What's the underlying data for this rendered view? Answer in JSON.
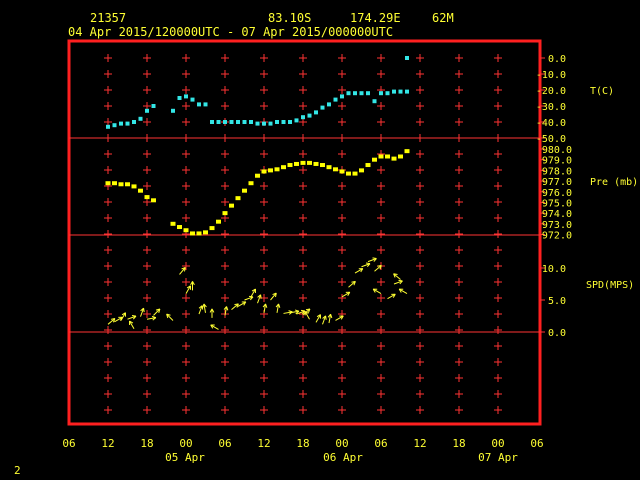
{
  "header": {
    "station_id": "21357",
    "latitude": "83.10S",
    "longitude": "174.29E",
    "elevation": "62M",
    "period": "04 Apr 2015/120000UTC - 07 Apr 2015/000000UTC"
  },
  "page_number": "2",
  "colors": {
    "frame": "#ff2020",
    "temperature": "#33e6e6",
    "pressure": "#ffff00",
    "wind": "#ffff33",
    "text": "#ffff33",
    "grid": "#ff3333"
  },
  "chart_data": [
    {
      "type": "scatter",
      "name": "temperature",
      "ylabel": "T(C)",
      "yticks": [
        "0.0",
        "-10.0",
        "-20.0",
        "-30.0",
        "-40.0",
        "-50.0"
      ],
      "ylim": [
        -50,
        0
      ],
      "x_hours": [
        2,
        3,
        4,
        5,
        6,
        7,
        8,
        9,
        12,
        13,
        14,
        15,
        16,
        17,
        18,
        19,
        20,
        21,
        22,
        23,
        24,
        25,
        26,
        27,
        28,
        29,
        30,
        31,
        32,
        33,
        34,
        35,
        36,
        37,
        38,
        39,
        40,
        41,
        42,
        43,
        44,
        45,
        46,
        47,
        48
      ],
      "values": [
        -43,
        -42,
        -41,
        -41,
        -40,
        -38,
        -33,
        -30,
        -33,
        -25,
        -24,
        -26,
        -29,
        -29,
        -40,
        -40,
        -40,
        -40,
        -40,
        -40,
        -40,
        -41,
        -41,
        -41,
        -40,
        -40,
        -40,
        -39,
        -37,
        -36,
        -34,
        -31,
        -29,
        -26,
        -24,
        -22,
        -22,
        -22,
        -22,
        -27,
        -22,
        -22,
        -21,
        -21,
        -21
      ],
      "outlier": {
        "x_hour": 48,
        "value": 0
      }
    },
    {
      "type": "scatter",
      "name": "pressure",
      "ylabel": "Pre (mb)",
      "yticks": [
        "980.0",
        "979.0",
        "978.0",
        "977.0",
        "976.0",
        "975.0",
        "974.0",
        "973.0",
        "972.0"
      ],
      "ylim": [
        972,
        980.5
      ],
      "x_hours": [
        2,
        3,
        4,
        5,
        6,
        7,
        8,
        9,
        12,
        13,
        14,
        15,
        16,
        17,
        18,
        19,
        20,
        21,
        22,
        23,
        24,
        25,
        26,
        27,
        28,
        29,
        30,
        31,
        32,
        33,
        34,
        35,
        36,
        37,
        38,
        39,
        40,
        41,
        42,
        43,
        44,
        45,
        46,
        47,
        48
      ],
      "values": [
        976.8,
        976.8,
        976.7,
        976.7,
        976.5,
        976.1,
        975.5,
        975.2,
        973.0,
        972.7,
        972.4,
        972.1,
        972.1,
        972.2,
        972.6,
        973.2,
        974.0,
        974.7,
        975.4,
        976.1,
        976.8,
        977.5,
        977.9,
        978.0,
        978.1,
        978.3,
        978.5,
        978.6,
        978.7,
        978.7,
        978.6,
        978.5,
        978.3,
        978.1,
        977.9,
        977.7,
        977.7,
        978.0,
        978.5,
        979.0,
        979.3,
        979.3,
        979.1,
        979.3,
        979.8
      ]
    },
    {
      "type": "scatter",
      "name": "wind",
      "ylabel": "SPD(MPS)",
      "yticks": [
        "10.0",
        "5.0",
        "0.0"
      ],
      "ylim": [
        0,
        12
      ],
      "x_hours": [
        2,
        3,
        4,
        5,
        6,
        7,
        8,
        9,
        12,
        13,
        14,
        15,
        16,
        17,
        18,
        19,
        20,
        21,
        22,
        23,
        24,
        25,
        26,
        27,
        28,
        29,
        30,
        31,
        32,
        33,
        34,
        35,
        36,
        37,
        38,
        39,
        40,
        41,
        42,
        43,
        44,
        45,
        46,
        47,
        48
      ],
      "speed": [
        1.2,
        1.6,
        1.8,
        2.0,
        0.5,
        2.4,
        2.0,
        2.6,
        1.8,
        9.0,
        6.0,
        6.5,
        2.8,
        3.0,
        2.2,
        0.4,
        2.6,
        3.5,
        4.0,
        5.0,
        5.5,
        4.5,
        3.0,
        5.0,
        3.0,
        2.9,
        3.0,
        2.8,
        2.7,
        2.0,
        1.5,
        1.2,
        1.4,
        1.8,
        5.5,
        7.0,
        9.2,
        10.2,
        11.0,
        9.5,
        6.0,
        5.2,
        7.5,
        8.2,
        6.0
      ],
      "direction_deg": [
        40,
        30,
        60,
        20,
        120,
        70,
        10,
        45,
        135,
        50,
        60,
        90,
        70,
        100,
        90,
        150,
        80,
        40,
        30,
        20,
        60,
        70,
        80,
        50,
        80,
        10,
        10,
        20,
        40,
        120,
        60,
        70,
        80,
        30,
        30,
        40,
        30,
        20,
        20,
        40,
        150,
        30,
        20,
        140,
        150
      ]
    }
  ],
  "x_axis": {
    "tick_labels": [
      "06",
      "12",
      "18",
      "00",
      "06",
      "12",
      "18",
      "00",
      "06",
      "12",
      "18",
      "00",
      "06"
    ],
    "date_labels": [
      "05 Apr",
      "06 Apr",
      "07 Apr"
    ]
  }
}
